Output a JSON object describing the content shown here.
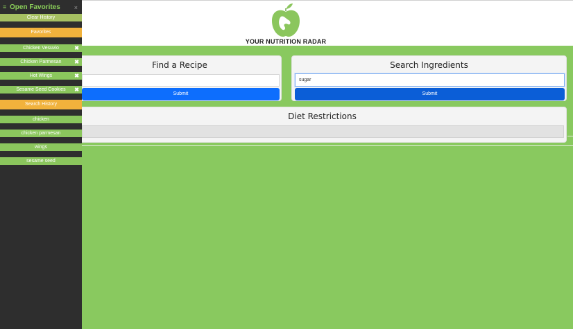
{
  "header": {
    "brand": "YOUR NUTRITION RADAR",
    "logo_icon": "apple-logo-icon",
    "brand_color": "#89c95f"
  },
  "recipe": {
    "title": "Find a Recipe",
    "input_value": "",
    "submit_label": "Submit"
  },
  "ingredients": {
    "title": "Search Ingredients",
    "input_value": "sugar",
    "submit_label": "Submit"
  },
  "diet": {
    "title": "Diet Restrictions"
  },
  "sidebar": {
    "menu_icon": "≡",
    "title": "Open Favorites",
    "close_icon": "×",
    "clear_label": "Clear History",
    "favorites_label": "Favorites",
    "favorites": [
      {
        "label": "Chicken Vesuvio"
      },
      {
        "label": "Chicken Parmesan"
      },
      {
        "label": "Hot Wings"
      },
      {
        "label": "Sesame Seed Cookies"
      }
    ],
    "delete_icon": "✖",
    "history_label": "Search History",
    "history": [
      {
        "label": "chicken"
      },
      {
        "label": "chicken parmesan"
      },
      {
        "label": "wings"
      },
      {
        "label": "sesame seed"
      }
    ]
  },
  "colors": {
    "background": "#89c95f",
    "sidebar": "#2e2e2e",
    "accent_orange": "#f1b23c",
    "button_blue": "#0d6efd"
  }
}
